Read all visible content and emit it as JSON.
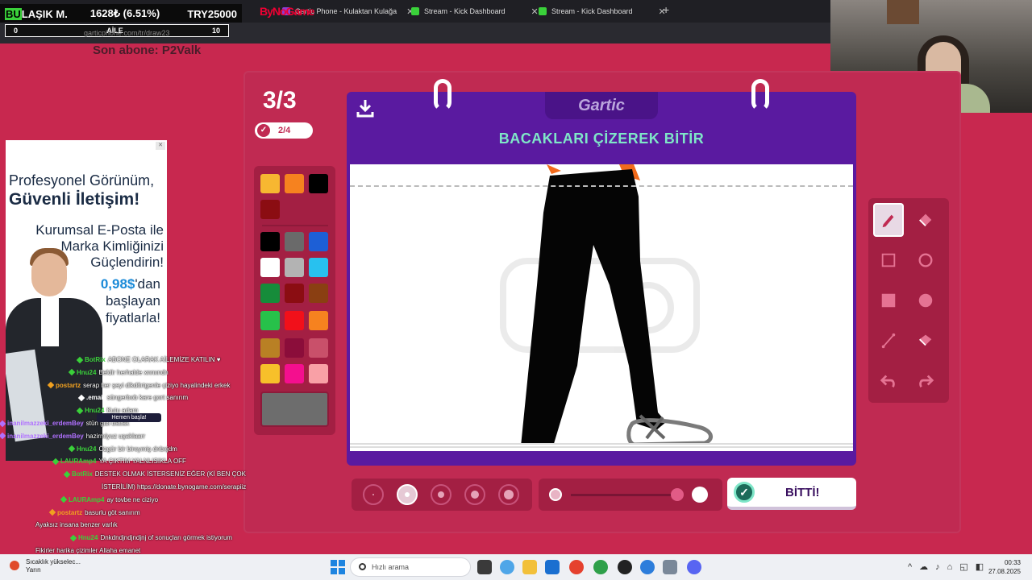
{
  "browser": {
    "ticker": {
      "team": "BULAŞIK M.",
      "team_hl": "BU",
      "team_rest": "LAŞIK M.",
      "price": "1628₺ (6.51%)",
      "currency": "TRY25000"
    },
    "tabs": [
      {
        "label": "Gartic Phone - Kulaktan Kulağa",
        "color": "#8f3bd1"
      },
      {
        "label": "Stream - Kick Dashboard",
        "color": "#3ad13a"
      },
      {
        "label": "Stream - Kick Dashboard",
        "color": "#3ad13a"
      }
    ],
    "new_tab": "+",
    "overlay_brand": "ByNoGame",
    "url": "garticphone.com/tr/draw23",
    "scoreboard": {
      "left": "0",
      "center": "AİLE",
      "right": "10"
    }
  },
  "overlay": {
    "last_sub": "Son abone: P2Valk"
  },
  "game": {
    "round": "3/3",
    "done_count": "2/4",
    "logo": "Gartic",
    "instruction": "BACAKLARI ÇİZEREK BİTİR",
    "done_button": "BİTTİ!",
    "palette": [
      "#f7b731",
      "#f6821f",
      "#000000",
      "#8b0d12",
      "#000000",
      "#6a6a6a",
      "#1d5fd6",
      "#ffffff",
      "#b3b3b3",
      "#28c1ef",
      "#168c3a",
      "#8b0d12",
      "#8a3f12",
      "#27c14a",
      "#f1101a",
      "#f6821f",
      "#b98024",
      "#8b0d3a",
      "#c9506a",
      "#f7c02a",
      "#f40f8e",
      "#f9a0a6"
    ],
    "current_color": "#6d6d6d",
    "tools": [
      {
        "name": "pencil-tool-icon",
        "active": true
      },
      {
        "name": "eraser-tool-icon",
        "active": false
      },
      {
        "name": "square-outline-tool-icon",
        "active": false
      },
      {
        "name": "circle-outline-tool-icon",
        "active": false
      },
      {
        "name": "square-fill-tool-icon",
        "active": false
      },
      {
        "name": "circle-fill-tool-icon",
        "active": false
      },
      {
        "name": "line-tool-icon",
        "active": false
      },
      {
        "name": "bucket-fill-tool-icon",
        "active": false
      },
      {
        "name": "undo-icon",
        "active": false
      },
      {
        "name": "redo-icon",
        "active": false
      }
    ],
    "brush_sizes_selected": 2
  },
  "ad": {
    "line1": "Profesyonel Görünüm,",
    "line2": "Güvenli İletişim!",
    "line3": "Kurumsal E-Posta ile",
    "line4": "Marka Kimliğinizi",
    "line5": "Güçlendirin!",
    "price": "0,98$",
    "price_rest": "'dan",
    "line6": "başlayan",
    "line7": "fiyatlarla!"
  },
  "chat": [
    {
      "user": "BotRix",
      "text": "ABONE OLARAK AİLEMİZE KATILIN ♥",
      "color": "#3ad13a"
    },
    {
      "user": "Hnu24",
      "text": "Beldir herhalde xnnxndn",
      "color": "#3ad13a"
    },
    {
      "user": "postartz",
      "text": "serap her şeyi dikdörtgenle çiziyo hayalindeki erkek",
      "color": "#f0a020"
    },
    {
      "user": ".email",
      "text": "süngerbob kare gort sanırım",
      "color": "#ffffff"
    },
    {
      "user": "Hnu24",
      "text": "Kutu adam",
      "color": "#3ad13a"
    },
    {
      "user": "inanilmazzeki_erdemBey",
      "text": "stün gibi bacak",
      "color": "#b070ff"
    },
    {
      "user": "inanilmazzeki_erdemBey",
      "text": "hazirmiyuz uşaklaarr",
      "color": "#b070ff"
    },
    {
      "user": "Hnu24",
      "text": "Özgür bir bireymiş dnbxjdm",
      "color": "#3ad13a"
    },
    {
      "user": "LAURAmp4",
      "text": "YA ÇIKTIM YALNLISIKLA OFF",
      "color": "#3ad13a"
    },
    {
      "user": "BotRix",
      "text": "DESTEK OLMAK İSTERSENİZ EĞER (Kİ BEN ÇOK",
      "color": "#3ad13a"
    },
    {
      "user": "",
      "text": "İSTERİLİM) https://donate.bynogame.com/serapiiz",
      "color": "#ffffff"
    },
    {
      "user": "LAURAmp4",
      "text": "ay tovbe ne ciziyo",
      "color": "#3ad13a"
    },
    {
      "user": "postartz",
      "text": "basurlu göt sanırım",
      "color": "#f0a020"
    },
    {
      "user": "",
      "text": "Ayaksız insana benzer varlık",
      "color": "#ffffff"
    },
    {
      "user": "Hnu24",
      "text": "Dnkdndjndjndjnj of sonuçları görmek istiyorum",
      "color": "#3ad13a"
    },
    {
      "user": "",
      "text": "Fikirler harika çizimler Allaha emanet",
      "color": "#ffffff"
    }
  ],
  "chat_chip": "Hemen başla!",
  "taskbar": {
    "weather_line1": "Sıcaklık yükselec...",
    "weather_line2": "Yarın",
    "search_placeholder": "Hızlı arama",
    "time": "00:33",
    "date": "27.08.2025"
  }
}
